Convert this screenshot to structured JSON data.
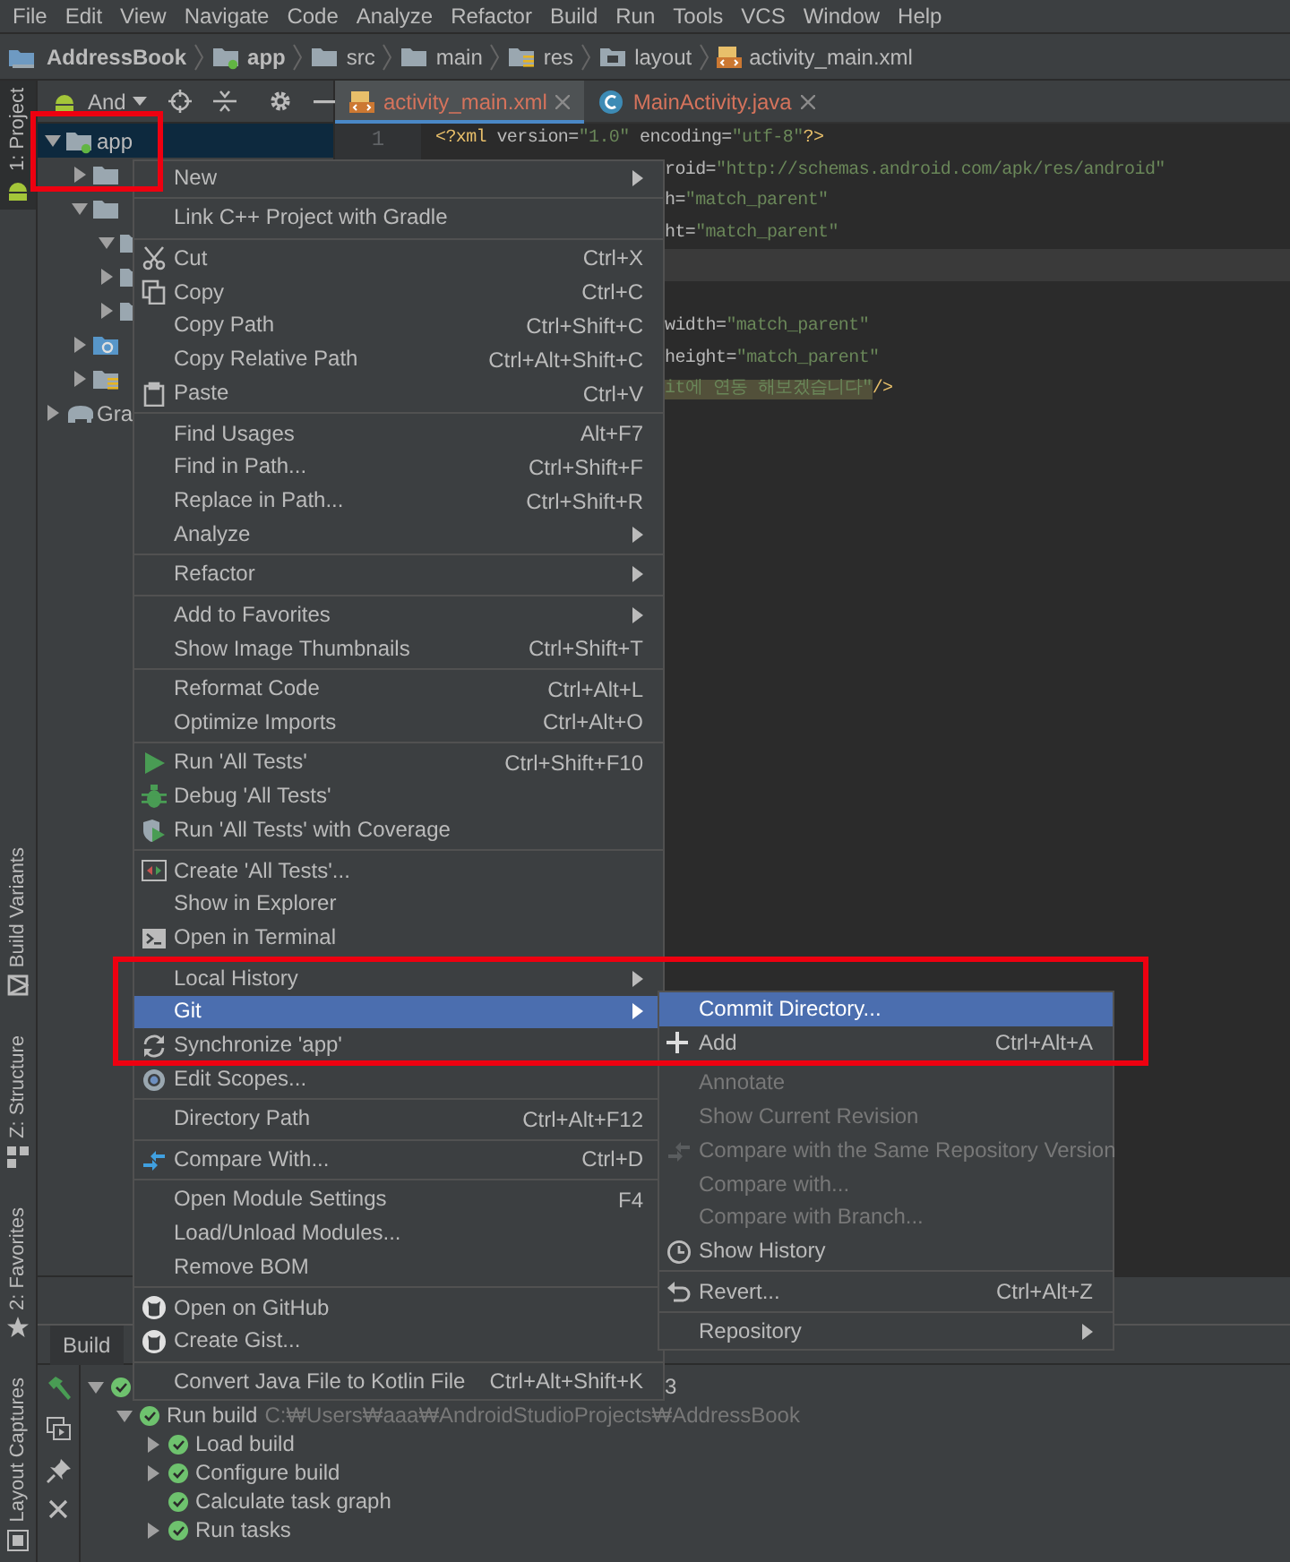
{
  "menu_bar": [
    "File",
    "Edit",
    "View",
    "Navigate",
    "Code",
    "Analyze",
    "Refactor",
    "Build",
    "Run",
    "Tools",
    "VCS",
    "Window",
    "Help"
  ],
  "breadcrumbs": [
    {
      "label": "AddressBook",
      "kind": "project"
    },
    {
      "label": "app",
      "kind": "module"
    },
    {
      "label": "src",
      "kind": "folder"
    },
    {
      "label": "main",
      "kind": "folder"
    },
    {
      "label": "res",
      "kind": "res"
    },
    {
      "label": "layout",
      "kind": "layout"
    },
    {
      "label": "activity_main.xml",
      "kind": "xml"
    }
  ],
  "tool_strip": [
    {
      "label": "1: Project",
      "kind": "android",
      "selected": true
    },
    {
      "label": "Build Variants",
      "kind": "variants",
      "selected": false
    },
    {
      "label": "Z: Structure",
      "kind": "structure",
      "selected": false
    },
    {
      "label": "2: Favorites",
      "kind": "star",
      "selected": false
    },
    {
      "label": "Layout Captures",
      "kind": "captures",
      "selected": false
    }
  ],
  "project_panel": {
    "view_selector": "And",
    "tree": [
      {
        "label": "app",
        "kind": "module",
        "expanded": true,
        "selected": true,
        "children": [
          {
            "kind": "folder",
            "expanded": false,
            "selected": false
          },
          {
            "kind": "folder",
            "expanded": true,
            "selected": false,
            "children": [
              {
                "kind": "folder",
                "expanded": true,
                "selected": false
              },
              {
                "kind": "folder",
                "expanded": false,
                "selected": false
              },
              {
                "kind": "folder",
                "expanded": false,
                "selected": false
              }
            ]
          },
          {
            "kind": "gear-folder",
            "expanded": false,
            "selected": false
          },
          {
            "kind": "res",
            "expanded": false,
            "selected": false
          }
        ]
      },
      {
        "label": "Gra",
        "kind": "gradle",
        "expanded": false,
        "selected": false
      }
    ]
  },
  "editor": {
    "tabs": [
      {
        "label": "activity_main.xml",
        "kind": "xml",
        "selected": true
      },
      {
        "label": "MainActivity.java",
        "kind": "java",
        "selected": false
      }
    ],
    "gutter": [
      "1"
    ],
    "lines": [
      {
        "current": false,
        "segments": [
          {
            "text": "<?xml",
            "kind": "tag"
          },
          {
            "text": " version=",
            "kind": "attr"
          },
          {
            "text": "\"1.0\"",
            "kind": "value"
          },
          {
            "text": " encoding=",
            "kind": "attr"
          },
          {
            "text": "\"utf-8\"",
            "kind": "value"
          },
          {
            "text": "?>",
            "kind": "tag"
          }
        ]
      },
      {
        "covered": true,
        "segments": [
          {
            "text": "roid=",
            "kind": "attr"
          },
          {
            "text": "\"http://schemas.android.com/apk/res/android\"",
            "kind": "value"
          }
        ]
      },
      {
        "covered": true,
        "segments": [
          {
            "text": "h=",
            "kind": "attr"
          },
          {
            "text": "\"match_parent\"",
            "kind": "value"
          }
        ]
      },
      {
        "covered": true,
        "segments": [
          {
            "text": "ht=",
            "kind": "attr"
          },
          {
            "text": "\"match_parent\"",
            "kind": "value"
          }
        ]
      },
      {
        "current": true
      },
      {
        "current": false
      },
      {
        "covered": true,
        "segments": [
          {
            "text": "width=",
            "kind": "attr"
          },
          {
            "text": "\"match_parent\"",
            "kind": "value"
          }
        ]
      },
      {
        "covered": true,
        "segments": [
          {
            "text": "height=",
            "kind": "attr"
          },
          {
            "text": "\"match_parent\"",
            "kind": "value"
          }
        ]
      },
      {
        "covered": true,
        "segments": [
          {
            "text": "it에 연동 해보겠습니다\"",
            "kind": "found"
          },
          {
            "text": "/>",
            "kind": "tag"
          }
        ]
      }
    ]
  },
  "build_panel": {
    "title": "Build",
    "tree": [
      {
        "label": "3",
        "covered": true,
        "expanded": true,
        "children": [
          {
            "label": "Run build",
            "detail": "C:₩Users₩aaa₩AndroidStudioProjects₩AddressBook",
            "expanded": true,
            "children": [
              {
                "label": "Load build",
                "expanded": false
              },
              {
                "label": "Configure build",
                "expanded": false
              },
              {
                "label": "Calculate task graph"
              },
              {
                "label": "Run tasks",
                "expanded": false
              }
            ]
          }
        ]
      }
    ]
  },
  "context_menu": {
    "groups": [
      [
        {
          "label": "New",
          "submenu": true,
          "selected": false
        }
      ],
      [
        {
          "label": "Link C++ Project with Gradle",
          "selected": false
        }
      ],
      [
        {
          "label": "Cut",
          "shortcut": "Ctrl+X",
          "kind": "cut",
          "selected": false
        },
        {
          "label": "Copy",
          "shortcut": "Ctrl+C",
          "kind": "copy",
          "selected": false
        },
        {
          "label": "Copy Path",
          "shortcut": "Ctrl+Shift+C",
          "selected": false
        },
        {
          "label": "Copy Relative Path",
          "shortcut": "Ctrl+Alt+Shift+C",
          "selected": false
        },
        {
          "label": "Paste",
          "shortcut": "Ctrl+V",
          "kind": "paste",
          "selected": false
        }
      ],
      [
        {
          "label": "Find Usages",
          "shortcut": "Alt+F7",
          "selected": false
        },
        {
          "label": "Find in Path...",
          "shortcut": "Ctrl+Shift+F",
          "selected": false
        },
        {
          "label": "Replace in Path...",
          "shortcut": "Ctrl+Shift+R",
          "selected": false
        },
        {
          "label": "Analyze",
          "submenu": true,
          "selected": false
        }
      ],
      [
        {
          "label": "Refactor",
          "submenu": true,
          "selected": false
        }
      ],
      [
        {
          "label": "Add to Favorites",
          "submenu": true,
          "selected": false
        },
        {
          "label": "Show Image Thumbnails",
          "shortcut": "Ctrl+Shift+T",
          "selected": false
        }
      ],
      [
        {
          "label": "Reformat Code",
          "shortcut": "Ctrl+Alt+L",
          "selected": false
        },
        {
          "label": "Optimize Imports",
          "shortcut": "Ctrl+Alt+O",
          "selected": false
        }
      ],
      [
        {
          "label": "Run 'All Tests'",
          "shortcut": "Ctrl+Shift+F10",
          "kind": "run",
          "selected": false
        },
        {
          "label": "Debug 'All Tests'",
          "kind": "debug",
          "selected": false
        },
        {
          "label": "Run 'All Tests' with Coverage",
          "kind": "coverage",
          "selected": false
        }
      ],
      [
        {
          "label": "Create 'All Tests'...",
          "kind": "create",
          "selected": false
        },
        {
          "label": "Show in Explorer",
          "selected": false
        },
        {
          "label": "Open in Terminal",
          "kind": "terminal",
          "selected": false
        }
      ],
      [
        {
          "label": "Local History",
          "submenu": true,
          "selected": false
        },
        {
          "label": "Git",
          "submenu": true,
          "selected": true
        },
        {
          "label": "Synchronize 'app'",
          "kind": "sync",
          "selected": false
        },
        {
          "label": "Edit Scopes...",
          "kind": "scope",
          "selected": false
        }
      ],
      [
        {
          "label": "Directory Path",
          "shortcut": "Ctrl+Alt+F12",
          "selected": false
        }
      ],
      [
        {
          "label": "Compare With...",
          "shortcut": "Ctrl+D",
          "kind": "compare",
          "selected": false
        }
      ],
      [
        {
          "label": "Open Module Settings",
          "shortcut": "F4",
          "selected": false
        },
        {
          "label": "Load/Unload Modules...",
          "selected": false
        },
        {
          "label": "Remove BOM",
          "selected": false
        }
      ],
      [
        {
          "label": "Open on GitHub",
          "kind": "github",
          "selected": false
        },
        {
          "label": "Create Gist...",
          "kind": "github",
          "selected": false
        }
      ],
      [
        {
          "label": "Convert Java File to Kotlin File",
          "shortcut": "Ctrl+Alt+Shift+K",
          "selected": false
        }
      ]
    ]
  },
  "git_submenu": {
    "groups": [
      [
        {
          "label": "Commit Directory...",
          "selected": true,
          "disabled": false
        },
        {
          "label": "Add",
          "shortcut": "Ctrl+Alt+A",
          "kind": "add",
          "selected": false,
          "disabled": false
        }
      ],
      [
        {
          "label": "Annotate",
          "selected": false,
          "disabled": true
        },
        {
          "label": "Show Current Revision",
          "selected": false,
          "disabled": true
        },
        {
          "label": "Compare with the Same Repository Version",
          "kind": "compare",
          "selected": false,
          "disabled": true
        },
        {
          "label": "Compare with...",
          "selected": false,
          "disabled": true
        },
        {
          "label": "Compare with Branch...",
          "selected": false,
          "disabled": true
        },
        {
          "label": "Show History",
          "kind": "history",
          "selected": false,
          "disabled": false
        }
      ],
      [
        {
          "label": "Revert...",
          "shortcut": "Ctrl+Alt+Z",
          "kind": "revert",
          "selected": false,
          "disabled": false
        }
      ],
      [
        {
          "label": "Repository",
          "submenu": true,
          "selected": false,
          "disabled": false
        }
      ]
    ]
  },
  "annotations": [
    {
      "kind": "frame"
    },
    {
      "kind": "frame"
    }
  ]
}
